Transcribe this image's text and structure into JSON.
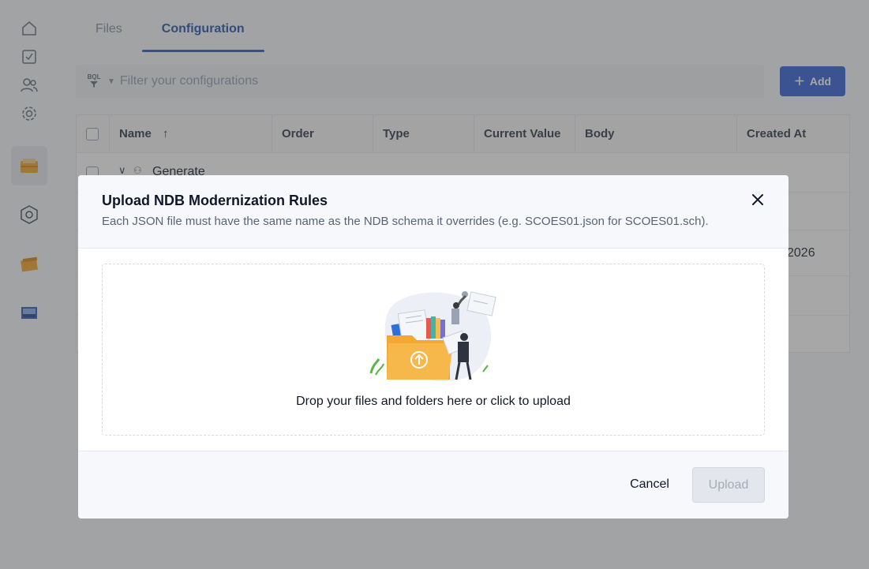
{
  "tabs": [
    {
      "label": "Files",
      "active": false
    },
    {
      "label": "Configuration",
      "active": true
    }
  ],
  "filter": {
    "badge": "BQL",
    "placeholder": "Filter your configurations"
  },
  "add_button": {
    "label": "Add"
  },
  "table": {
    "columns": [
      "Name",
      "Order",
      "Type",
      "Current Value",
      "Body",
      "Created At"
    ],
    "sort_indicator": "↑",
    "rows": [
      {
        "name": "Generate"
      },
      {
        "created_partial": "2026"
      }
    ]
  },
  "modal": {
    "title": "Upload NDB Modernization Rules",
    "subtitle": "Each JSON file must have the same name as the NDB schema it overrides (e.g. SCOES01.json for SCOES01.sch).",
    "dropzone_text": "Drop your files and folders here or click to upload",
    "cancel_label": "Cancel",
    "upload_label": "Upload"
  },
  "colors": {
    "primary": "#3b67d6",
    "tab_active": "#2f5ab0",
    "folder": "#f2a833"
  }
}
